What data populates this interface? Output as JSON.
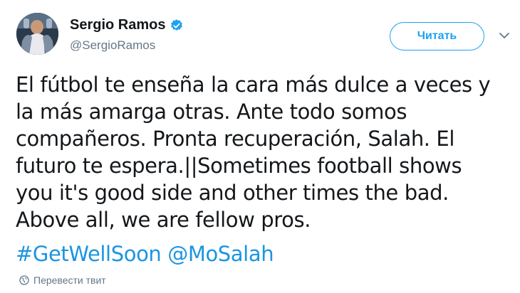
{
  "user": {
    "display_name": "Sergio Ramos",
    "handle": "@SergioRamos",
    "verified": true,
    "avatar": "avatar-photo"
  },
  "follow_button": {
    "label": "Читать"
  },
  "caret": {
    "icon": "chevron-down-icon"
  },
  "tweet": {
    "text": "El fútbol te enseña la cara más dulce a veces y\nla más amarga otras. Ante todo somos\ncompañeros. Pronta recuperación, Salah. El\nfuturo te espera.||Sometimes football shows\nyou it's good side and other times the bad.\nAbove all, we are fellow pros.",
    "hashtag": "#GetWellSoon",
    "mention": "@MoSalah"
  },
  "translate": {
    "label": "Перевести твит",
    "icon": "globe-icon"
  },
  "colors": {
    "accent": "#1da1f2",
    "link": "#1b95e0",
    "secondary_text": "#657786",
    "text": "#14171a"
  }
}
